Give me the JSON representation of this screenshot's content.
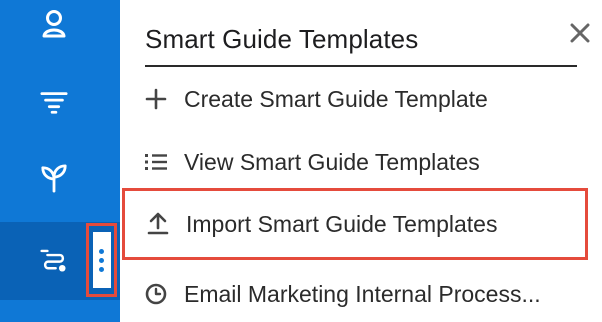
{
  "rail": {
    "items": [
      {
        "icon": "user-icon"
      },
      {
        "icon": "filter-icon"
      },
      {
        "icon": "sprout-icon"
      },
      {
        "icon": "process-flow-icon",
        "active": true
      }
    ],
    "kebab_icon": "more-vertical-icon"
  },
  "panel": {
    "title": "Smart Guide Templates",
    "close_icon": "close-icon",
    "items": [
      {
        "label": "Create Smart Guide Template",
        "icon": "plus-icon"
      },
      {
        "label": "View Smart Guide Templates",
        "icon": "list-icon"
      },
      {
        "label": "Import Smart Guide Templates",
        "icon": "upload-icon",
        "highlighted": true
      },
      {
        "label": "Email Marketing Internal Process...",
        "icon": "clock-icon"
      }
    ]
  },
  "colors": {
    "rail": "#0f78d6",
    "rail_active": "#0a62b6",
    "highlight": "#e54b3c"
  }
}
